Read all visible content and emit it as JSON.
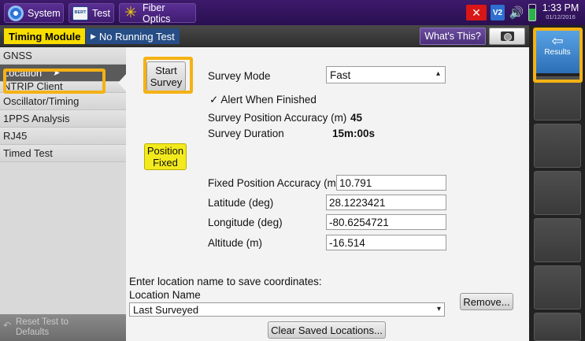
{
  "topbar": {
    "tabs": [
      {
        "label": "System",
        "icon": "gear-icon"
      },
      {
        "label": "Test",
        "icon": "bert-icon",
        "icon_text": "BERT"
      },
      {
        "label": "Fiber Optics",
        "icon": "sun-icon"
      }
    ],
    "status_icons": {
      "alert": "✕",
      "vnc": "V2"
    },
    "clock": {
      "time": "1:33 PM",
      "date": "01/12/2016"
    }
  },
  "subbar": {
    "module": "Timing Module",
    "test_status": "No Running Test",
    "whats_this": "What's This?"
  },
  "sidebar": {
    "items": [
      {
        "label": "GNSS"
      },
      {
        "label": "Location"
      },
      {
        "label": "NTRIP Client"
      },
      {
        "label": "Oscillator/Timing"
      },
      {
        "label": "1PPS Analysis"
      },
      {
        "label": "RJ45"
      },
      {
        "label": "Timed Test"
      }
    ],
    "active_index": 1,
    "reset": {
      "line1": "Reset Test to",
      "line2": "Defaults"
    }
  },
  "main": {
    "start_survey": {
      "line1": "Start",
      "line2": "Survey"
    },
    "survey_mode": {
      "label": "Survey Mode",
      "value": "Fast"
    },
    "alert_checkbox": {
      "label": "Alert When Finished",
      "checked": true
    },
    "survey_accuracy": {
      "label": "Survey Position Accuracy (m)",
      "value": "45"
    },
    "survey_duration": {
      "label": "Survey Duration",
      "value": "15m:00s"
    },
    "position_fixed": {
      "line1": "Position",
      "line2": "Fixed"
    },
    "fixed_accuracy": {
      "label": "Fixed Position Accuracy (m)",
      "value": "10.791"
    },
    "latitude": {
      "label": "Latitude (deg)",
      "value": "28.1223421"
    },
    "longitude": {
      "label": "Longitude (deg)",
      "value": "-80.6254721"
    },
    "altitude": {
      "label": "Altitude (m)",
      "value": "-16.514"
    },
    "save_prompt": "Enter location name to save coordinates:",
    "location_name": {
      "label": "Location Name",
      "value": "Last Surveyed"
    },
    "remove_button": "Remove...",
    "clear_button": "Clear Saved Locations..."
  },
  "right_panel": {
    "results_label": "Results"
  },
  "colors": {
    "highlight": "#f5b214",
    "module_yellow": "#f7dd00",
    "title_bar": "#3d1a6b"
  }
}
